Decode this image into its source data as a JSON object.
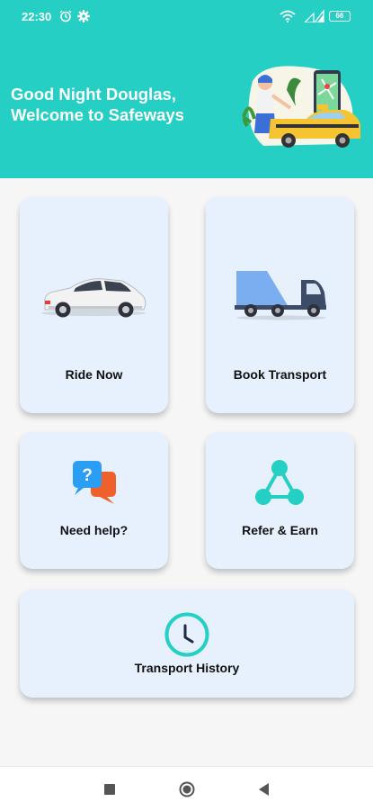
{
  "status_bar": {
    "time": "22:30",
    "battery": "66",
    "icons": [
      "alarm-icon",
      "gear-icon",
      "wifi-icon",
      "signal-icon",
      "battery-icon"
    ]
  },
  "header": {
    "greeting_line1": "Good Night Douglas,",
    "greeting_line2": "Welcome to Safeways",
    "background_color": "#25cfc4"
  },
  "cards": {
    "ride_now": {
      "label": "Ride Now",
      "icon": "car-icon"
    },
    "book_transport": {
      "label": "Book Transport",
      "icon": "truck-icon"
    },
    "need_help": {
      "label": "Need help?",
      "icon": "help-chat-icon"
    },
    "refer_earn": {
      "label": "Refer & Earn",
      "icon": "share-network-icon"
    },
    "transport_history": {
      "label": "Transport History",
      "icon": "clock-icon"
    }
  },
  "colors": {
    "accent": "#25cfc4",
    "card_bg": "#e7f1fd",
    "help_blue": "#2a9df4",
    "help_orange": "#f0602a"
  },
  "nav_bar": {
    "icons": [
      "recents-square-icon",
      "home-circle-icon",
      "back-triangle-icon"
    ]
  }
}
